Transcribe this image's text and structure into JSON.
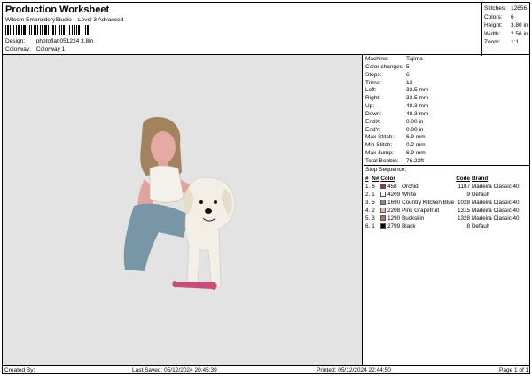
{
  "header": {
    "title": "Production Worksheet",
    "subtitle": "Wilcom EmbroideryStudio – Level 3 Advanced",
    "design_label": "Design:",
    "design_value": "photoflat 051224 3,8in",
    "colorway_label": "Colorway:",
    "colorway_value": "Colorway 1"
  },
  "summary": [
    {
      "label": "Stitches:",
      "value": "12656"
    },
    {
      "label": "Colors:",
      "value": "6"
    },
    {
      "label": "Height:",
      "value": "3.80 in"
    },
    {
      "label": "Width:",
      "value": "2.56 in"
    },
    {
      "label": "Zoom:",
      "value": "1:1"
    }
  ],
  "machine_params": [
    {
      "label": "Machine:",
      "value": "Tajima"
    },
    {
      "label": "Color changes:",
      "value": "5"
    },
    {
      "label": "Stops:",
      "value": "6"
    },
    {
      "label": "Trims:",
      "value": "13"
    },
    {
      "label": "Left:",
      "value": "32.5 mm"
    },
    {
      "label": "Right:",
      "value": "32.5 mm"
    },
    {
      "label": "Up:",
      "value": "48.3 mm"
    },
    {
      "label": "Down:",
      "value": "48.3 mm"
    },
    {
      "label": "EndX:",
      "value": "0.00 in"
    },
    {
      "label": "EndY:",
      "value": "0.00 in"
    },
    {
      "label": "Max Stitch:",
      "value": "6.9 mm"
    },
    {
      "label": "Min Stitch:",
      "value": "0.2 mm"
    },
    {
      "label": "Max Jump:",
      "value": "6.9 mm"
    },
    {
      "label": "Total Bobbin:",
      "value": "76.22ft"
    }
  ],
  "stop_sequence": {
    "title": "Stop Sequence:",
    "columns": {
      "stop": "#",
      "needle": "N#",
      "color": "Color",
      "code": "Code",
      "brand": "Brand"
    },
    "rows": [
      {
        "stop": "1.",
        "needle": "6",
        "swatch": "#8e3a55",
        "color_no": "458",
        "name": "Orchid",
        "code": "1187",
        "brand": "Madeira Classic 40"
      },
      {
        "stop": "2.",
        "needle": "1",
        "swatch": "#ffffff",
        "color_no": "4209",
        "name": "White",
        "code": "9",
        "brand": "Default"
      },
      {
        "stop": "3.",
        "needle": "5",
        "swatch": "#6e8fa6",
        "color_no": "1690",
        "name": "Country Kitchen Blue",
        "code": "1028",
        "brand": "Madeira Classic 40"
      },
      {
        "stop": "4.",
        "needle": "2",
        "swatch": "#e8b3a8",
        "color_no": "2208",
        "name": "Pink Grapefruit",
        "code": "1315",
        "brand": "Madeira Classic 40"
      },
      {
        "stop": "5.",
        "needle": "3",
        "swatch": "#a07858",
        "color_no": "1290",
        "name": "Buckskin",
        "code": "1328",
        "brand": "Madeira Classic 40"
      },
      {
        "stop": "6.",
        "needle": "1",
        "swatch": "#000000",
        "color_no": "2799",
        "name": "Black",
        "code": "8",
        "brand": "Default"
      }
    ]
  },
  "footer": {
    "created_by": "Created By:",
    "last_saved": "Last Saved: 05/12/2024 20:45:39",
    "printed": "Printed: 05/12/2024 22:44:50",
    "page": "Page 1 of 1"
  }
}
